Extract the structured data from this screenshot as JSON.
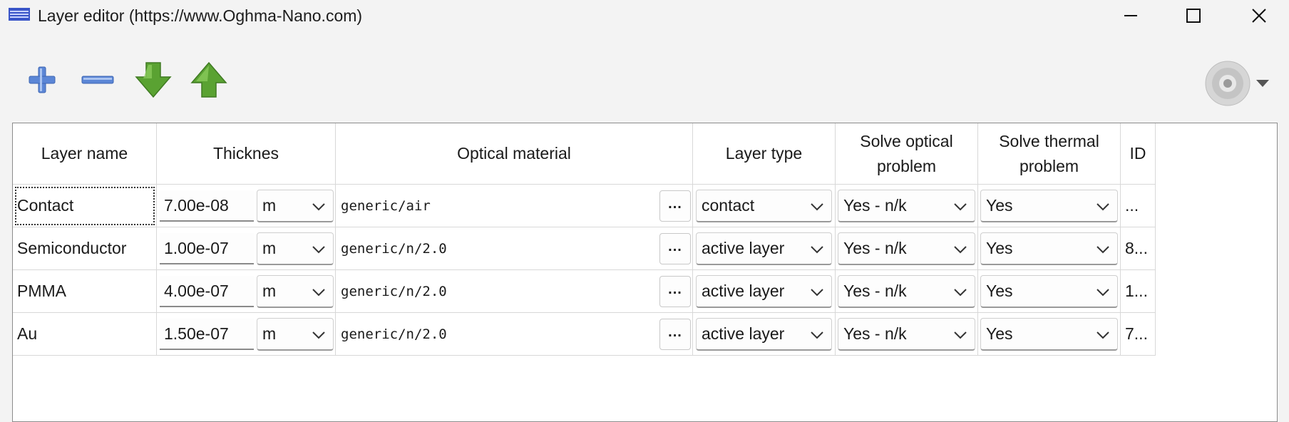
{
  "window": {
    "title": "Layer editor (https://www.Oghma-Nano.com)"
  },
  "icons": {
    "app": "menu-lines-icon",
    "minimize": "minimize-icon",
    "maximize": "maximize-icon",
    "close": "close-icon",
    "add": "plus-icon",
    "remove": "minus-icon",
    "down": "arrow-down-icon",
    "up": "arrow-up-icon",
    "menu": "disc-menu-icon"
  },
  "colors": {
    "accent_blue": "#4d7fd1",
    "arrow_green": "#5aa232"
  },
  "table": {
    "headers": {
      "name": "Layer name",
      "thickness": "Thicknes",
      "optical": "Optical material",
      "type": "Layer type",
      "solve_optical_1": "Solve optical",
      "solve_optical_2": "problem",
      "solve_thermal_1": "Solve thermal",
      "solve_thermal_2": "problem",
      "id": "ID"
    },
    "rows": [
      {
        "name": "Contact",
        "thickness": "7.00e-08",
        "unit": "m",
        "material": "generic/air",
        "dots": "...",
        "type": "contact",
        "optical": "Yes - n/k",
        "thermal": "Yes",
        "id": "..."
      },
      {
        "name": "Semiconductor",
        "thickness": "1.00e-07",
        "unit": "m",
        "material": "generic/n/2.0",
        "dots": "...",
        "type": "active layer",
        "optical": "Yes - n/k",
        "thermal": "Yes",
        "id": "8..."
      },
      {
        "name": "PMMA",
        "thickness": "4.00e-07",
        "unit": "m",
        "material": "generic/n/2.0",
        "dots": "...",
        "type": "active layer",
        "optical": "Yes - n/k",
        "thermal": "Yes",
        "id": "1..."
      },
      {
        "name": "Au",
        "thickness": "1.50e-07",
        "unit": "m",
        "material": "generic/n/2.0",
        "dots": "...",
        "type": "active layer",
        "optical": "Yes - n/k",
        "thermal": "Yes",
        "id": "7..."
      }
    ]
  }
}
